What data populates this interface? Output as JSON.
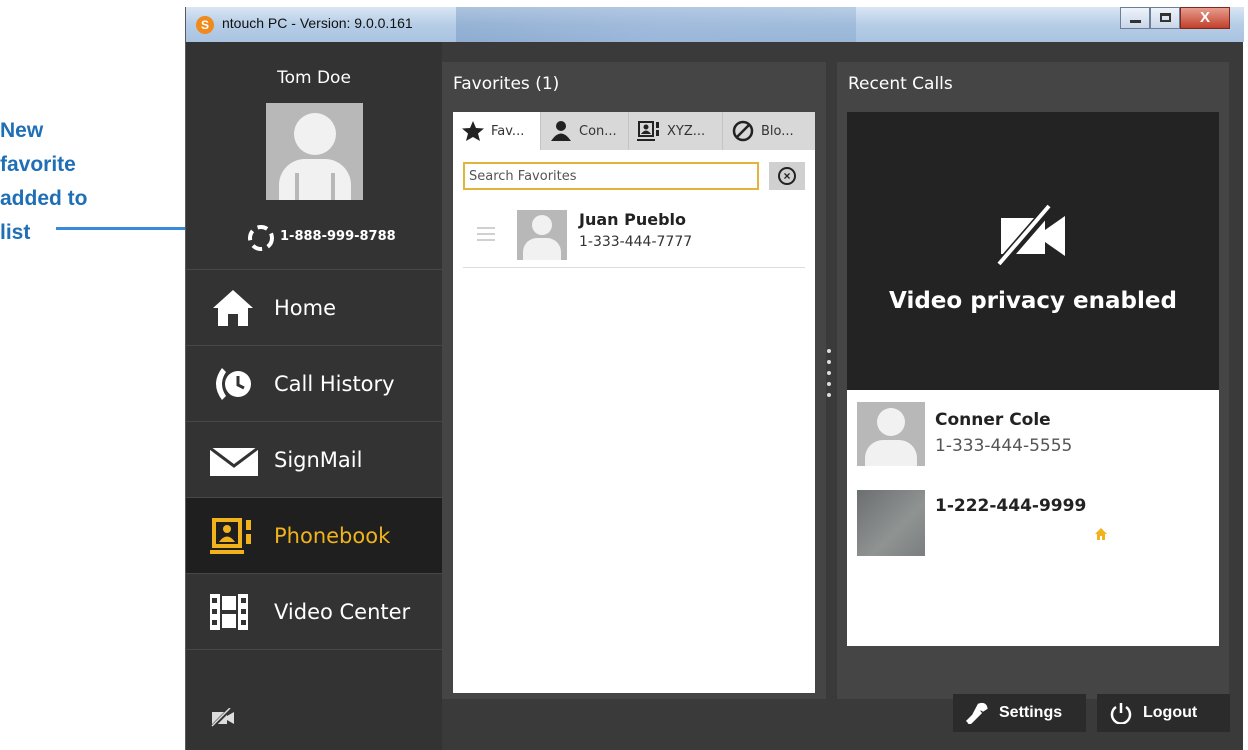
{
  "annotation": {
    "lines": [
      "New",
      "favorite",
      "added to",
      "list"
    ]
  },
  "window": {
    "title": "ntouch PC  -  Version: 9.0.0.161",
    "close_glyph": "X"
  },
  "sidebar": {
    "user_name": "Tom Doe",
    "user_number": "1-888-999-8788",
    "items": [
      {
        "label": "Home",
        "icon": "home-icon",
        "active": false
      },
      {
        "label": "Call History",
        "icon": "call-history-icon",
        "active": false
      },
      {
        "label": "SignMail",
        "icon": "envelope-icon",
        "active": false
      },
      {
        "label": "Phonebook",
        "icon": "phonebook-icon",
        "active": true
      },
      {
        "label": "Video Center",
        "icon": "film-icon",
        "active": false
      }
    ]
  },
  "favorites": {
    "title": "Favorites (1)",
    "tabs": [
      {
        "label": "Fav...",
        "icon": "star-icon"
      },
      {
        "label": "Con...",
        "icon": "contacts-icon"
      },
      {
        "label": "XYZ...",
        "icon": "phonebook-icon"
      },
      {
        "label": "Blo...",
        "icon": "blocked-icon"
      }
    ],
    "search_placeholder": "Search Favorites",
    "entries": [
      {
        "name": "Juan Pueblo",
        "number": "1-333-444-7777"
      }
    ]
  },
  "recent": {
    "title": "Recent Calls",
    "video_status": "Video privacy enabled",
    "calls": [
      {
        "name": "Conner Cole",
        "number": "1-333-444-5555"
      },
      {
        "name": "1-222-444-9999",
        "number": ""
      }
    ]
  },
  "footer": {
    "settings_label": "Settings",
    "logout_label": "Logout"
  },
  "colors": {
    "accent": "#f1b31c",
    "annotation": "#1f6fb7",
    "panel": "#454545",
    "sidebar": "#333333"
  }
}
